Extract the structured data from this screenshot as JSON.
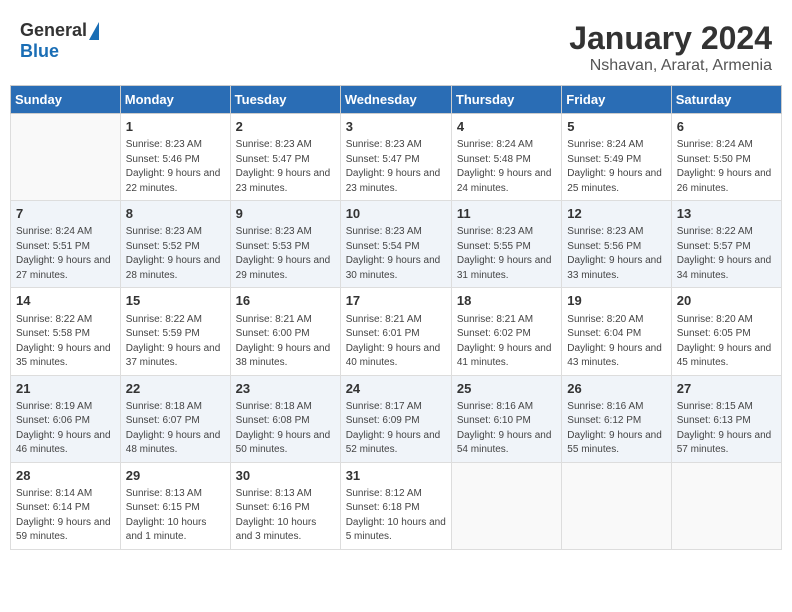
{
  "header": {
    "logo_general": "General",
    "logo_blue": "Blue",
    "month_title": "January 2024",
    "location": "Nshavan, Ararat, Armenia"
  },
  "weekdays": [
    "Sunday",
    "Monday",
    "Tuesday",
    "Wednesday",
    "Thursday",
    "Friday",
    "Saturday"
  ],
  "weeks": [
    [
      {
        "day": "",
        "sunrise": "",
        "sunset": "",
        "daylight": ""
      },
      {
        "day": "1",
        "sunrise": "Sunrise: 8:23 AM",
        "sunset": "Sunset: 5:46 PM",
        "daylight": "Daylight: 9 hours and 22 minutes."
      },
      {
        "day": "2",
        "sunrise": "Sunrise: 8:23 AM",
        "sunset": "Sunset: 5:47 PM",
        "daylight": "Daylight: 9 hours and 23 minutes."
      },
      {
        "day": "3",
        "sunrise": "Sunrise: 8:23 AM",
        "sunset": "Sunset: 5:47 PM",
        "daylight": "Daylight: 9 hours and 23 minutes."
      },
      {
        "day": "4",
        "sunrise": "Sunrise: 8:24 AM",
        "sunset": "Sunset: 5:48 PM",
        "daylight": "Daylight: 9 hours and 24 minutes."
      },
      {
        "day": "5",
        "sunrise": "Sunrise: 8:24 AM",
        "sunset": "Sunset: 5:49 PM",
        "daylight": "Daylight: 9 hours and 25 minutes."
      },
      {
        "day": "6",
        "sunrise": "Sunrise: 8:24 AM",
        "sunset": "Sunset: 5:50 PM",
        "daylight": "Daylight: 9 hours and 26 minutes."
      }
    ],
    [
      {
        "day": "7",
        "sunrise": "Sunrise: 8:24 AM",
        "sunset": "Sunset: 5:51 PM",
        "daylight": "Daylight: 9 hours and 27 minutes."
      },
      {
        "day": "8",
        "sunrise": "Sunrise: 8:23 AM",
        "sunset": "Sunset: 5:52 PM",
        "daylight": "Daylight: 9 hours and 28 minutes."
      },
      {
        "day": "9",
        "sunrise": "Sunrise: 8:23 AM",
        "sunset": "Sunset: 5:53 PM",
        "daylight": "Daylight: 9 hours and 29 minutes."
      },
      {
        "day": "10",
        "sunrise": "Sunrise: 8:23 AM",
        "sunset": "Sunset: 5:54 PM",
        "daylight": "Daylight: 9 hours and 30 minutes."
      },
      {
        "day": "11",
        "sunrise": "Sunrise: 8:23 AM",
        "sunset": "Sunset: 5:55 PM",
        "daylight": "Daylight: 9 hours and 31 minutes."
      },
      {
        "day": "12",
        "sunrise": "Sunrise: 8:23 AM",
        "sunset": "Sunset: 5:56 PM",
        "daylight": "Daylight: 9 hours and 33 minutes."
      },
      {
        "day": "13",
        "sunrise": "Sunrise: 8:22 AM",
        "sunset": "Sunset: 5:57 PM",
        "daylight": "Daylight: 9 hours and 34 minutes."
      }
    ],
    [
      {
        "day": "14",
        "sunrise": "Sunrise: 8:22 AM",
        "sunset": "Sunset: 5:58 PM",
        "daylight": "Daylight: 9 hours and 35 minutes."
      },
      {
        "day": "15",
        "sunrise": "Sunrise: 8:22 AM",
        "sunset": "Sunset: 5:59 PM",
        "daylight": "Daylight: 9 hours and 37 minutes."
      },
      {
        "day": "16",
        "sunrise": "Sunrise: 8:21 AM",
        "sunset": "Sunset: 6:00 PM",
        "daylight": "Daylight: 9 hours and 38 minutes."
      },
      {
        "day": "17",
        "sunrise": "Sunrise: 8:21 AM",
        "sunset": "Sunset: 6:01 PM",
        "daylight": "Daylight: 9 hours and 40 minutes."
      },
      {
        "day": "18",
        "sunrise": "Sunrise: 8:21 AM",
        "sunset": "Sunset: 6:02 PM",
        "daylight": "Daylight: 9 hours and 41 minutes."
      },
      {
        "day": "19",
        "sunrise": "Sunrise: 8:20 AM",
        "sunset": "Sunset: 6:04 PM",
        "daylight": "Daylight: 9 hours and 43 minutes."
      },
      {
        "day": "20",
        "sunrise": "Sunrise: 8:20 AM",
        "sunset": "Sunset: 6:05 PM",
        "daylight": "Daylight: 9 hours and 45 minutes."
      }
    ],
    [
      {
        "day": "21",
        "sunrise": "Sunrise: 8:19 AM",
        "sunset": "Sunset: 6:06 PM",
        "daylight": "Daylight: 9 hours and 46 minutes."
      },
      {
        "day": "22",
        "sunrise": "Sunrise: 8:18 AM",
        "sunset": "Sunset: 6:07 PM",
        "daylight": "Daylight: 9 hours and 48 minutes."
      },
      {
        "day": "23",
        "sunrise": "Sunrise: 8:18 AM",
        "sunset": "Sunset: 6:08 PM",
        "daylight": "Daylight: 9 hours and 50 minutes."
      },
      {
        "day": "24",
        "sunrise": "Sunrise: 8:17 AM",
        "sunset": "Sunset: 6:09 PM",
        "daylight": "Daylight: 9 hours and 52 minutes."
      },
      {
        "day": "25",
        "sunrise": "Sunrise: 8:16 AM",
        "sunset": "Sunset: 6:10 PM",
        "daylight": "Daylight: 9 hours and 54 minutes."
      },
      {
        "day": "26",
        "sunrise": "Sunrise: 8:16 AM",
        "sunset": "Sunset: 6:12 PM",
        "daylight": "Daylight: 9 hours and 55 minutes."
      },
      {
        "day": "27",
        "sunrise": "Sunrise: 8:15 AM",
        "sunset": "Sunset: 6:13 PM",
        "daylight": "Daylight: 9 hours and 57 minutes."
      }
    ],
    [
      {
        "day": "28",
        "sunrise": "Sunrise: 8:14 AM",
        "sunset": "Sunset: 6:14 PM",
        "daylight": "Daylight: 9 hours and 59 minutes."
      },
      {
        "day": "29",
        "sunrise": "Sunrise: 8:13 AM",
        "sunset": "Sunset: 6:15 PM",
        "daylight": "Daylight: 10 hours and 1 minute."
      },
      {
        "day": "30",
        "sunrise": "Sunrise: 8:13 AM",
        "sunset": "Sunset: 6:16 PM",
        "daylight": "Daylight: 10 hours and 3 minutes."
      },
      {
        "day": "31",
        "sunrise": "Sunrise: 8:12 AM",
        "sunset": "Sunset: 6:18 PM",
        "daylight": "Daylight: 10 hours and 5 minutes."
      },
      {
        "day": "",
        "sunrise": "",
        "sunset": "",
        "daylight": ""
      },
      {
        "day": "",
        "sunrise": "",
        "sunset": "",
        "daylight": ""
      },
      {
        "day": "",
        "sunrise": "",
        "sunset": "",
        "daylight": ""
      }
    ]
  ]
}
